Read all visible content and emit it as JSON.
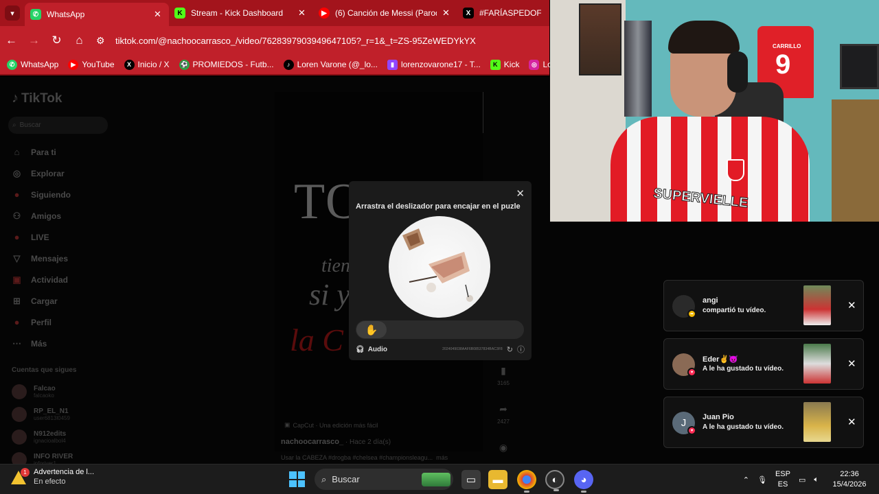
{
  "browser": {
    "tabs": [
      {
        "label": "WhatsApp",
        "favicon": "whatsapp-icon",
        "color": "#25d366",
        "active": true
      },
      {
        "label": "Stream - Kick Dashboard",
        "favicon": "kick-icon",
        "color": "#53fc18",
        "active": false
      },
      {
        "label": "(6) Canción de Messi (Parod",
        "favicon": "youtube-icon",
        "color": "#ff0000",
        "active": false
      },
      {
        "label": "#FARÍASPEDOFILO en",
        "favicon": "x-icon",
        "color": "#000000",
        "active": false
      }
    ],
    "url": "tiktok.com/@nachoocarrasco_/video/7628397903949647105?_r=1&_t=ZS-95ZeWEDYkYX",
    "bookmarks": [
      {
        "label": "WhatsApp",
        "icon": "whatsapp-icon"
      },
      {
        "label": "YouTube",
        "icon": "youtube-icon"
      },
      {
        "label": "Inicio / X",
        "icon": "x-icon"
      },
      {
        "label": "PROMIEDOS - Futb...",
        "icon": "promiedos-icon"
      },
      {
        "label": "Loren Varone (@_lo...",
        "icon": "tiktok-icon"
      },
      {
        "label": "lorenzovarone17 - T...",
        "icon": "twitch-icon"
      },
      {
        "label": "Kick",
        "icon": "kick-icon"
      },
      {
        "label": "Loren",
        "icon": "instagram-icon"
      }
    ]
  },
  "tiktok": {
    "logo": "TikTok",
    "search_placeholder": "Buscar",
    "nav": [
      {
        "label": "Para ti",
        "icon": "home-icon"
      },
      {
        "label": "Explorar",
        "icon": "compass-icon"
      },
      {
        "label": "Siguiendo",
        "icon": "following-icon"
      },
      {
        "label": "Amigos",
        "icon": "friends-icon"
      },
      {
        "label": "LIVE",
        "icon": "live-icon"
      },
      {
        "label": "Mensajes",
        "icon": "messages-icon"
      },
      {
        "label": "Actividad",
        "icon": "activity-icon"
      },
      {
        "label": "Cargar",
        "icon": "upload-icon"
      },
      {
        "label": "Perfil",
        "icon": "profile-icon"
      },
      {
        "label": "Más",
        "icon": "more-icon"
      }
    ],
    "following_title": "Cuentas que sigues",
    "following": [
      {
        "name": "Falcao",
        "handle": "falcaoko"
      },
      {
        "name": "RP_EL_N1",
        "handle": "user6813l0459"
      },
      {
        "name": "N912edits",
        "handle": "ignacioalbol4"
      },
      {
        "name": "INFO RIVER",
        "handle": "inforiver1"
      }
    ],
    "video": {
      "title_text": "TODO",
      "line1": "tien",
      "line2": "si y",
      "line3": "la C",
      "capcut": "CapCut · Una edición más fácil",
      "author": "nachoocarrasco_",
      "time": " · Hace 2 día(s)",
      "caption": "Usar la CABEZA #drogba #chelsea #championsleagu...",
      "more": "más",
      "saves": "3165",
      "shares": "2427"
    }
  },
  "captcha": {
    "title": "Arrastra el deslizador para encajar en el puzle",
    "audio_label": "Audio",
    "code": "2024049038AAF6B08537834BAC3F8"
  },
  "notifications": [
    {
      "name": "angi",
      "text": "compartió tu vídeo.",
      "dot_color": "#f2b800",
      "avatar_color": "#2a2a2a"
    },
    {
      "name": "Eder✌️😈",
      "text": "A le ha gustado tu vídeo.",
      "dot_color": "#fe2c55",
      "avatar_color": "#8a6a55"
    },
    {
      "name": "Juan Pio",
      "text": "A le ha gustado tu vídeo.",
      "dot_color": "#fe2c55",
      "avatar_color": "#5a6a78",
      "initial": "J"
    }
  ],
  "taskbar": {
    "warning_title": "Advertencia de l...",
    "warning_sub": "En efecto",
    "warning_count": "1",
    "search_label": "Buscar",
    "lang_top": "ESP",
    "lang_bottom": "ES",
    "time": "22:36",
    "date": "15/4/2026"
  }
}
